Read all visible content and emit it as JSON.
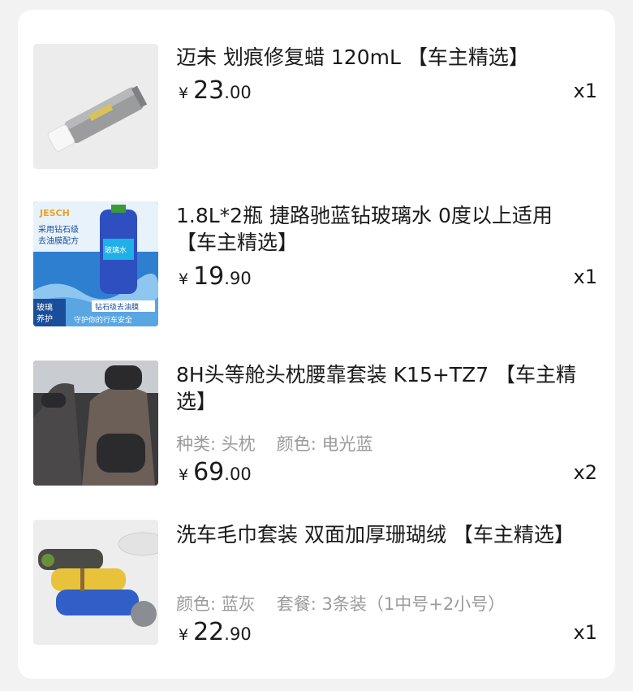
{
  "currency_symbol": "¥",
  "items": [
    {
      "title": "迈未 划痕修复蜡 120mL 【车主精选】",
      "price_int": "23",
      "price_dec": ".00",
      "qty": "x1",
      "image_icon": "scratch-repair-wax-tube-image"
    },
    {
      "title": "1.8L*2瓶 捷路驰蓝钻玻璃水 0度以上适用 【车主精选】",
      "price_int": "19",
      "price_dec": ".90",
      "qty": "x1",
      "image_icon": "windshield-washer-fluid-image",
      "image_text": {
        "brand": "JESCH",
        "line1": "采用钻石级",
        "line2": "去油膜配方",
        "tag": "玻璃水",
        "badge": "钻石级去油膜",
        "corner": "玻璃\n养护",
        "footer": "守护你的行车安全"
      }
    },
    {
      "title": "8H头等舱头枕腰靠套装 K15+TZ7 【车主精选】",
      "spec1_label": "种类:",
      "spec1_value": "头枕",
      "spec2_label": "颜色:",
      "spec2_value": "电光蓝",
      "price_int": "69",
      "price_dec": ".00",
      "qty": "x2",
      "image_icon": "headrest-lumbar-pillow-image"
    },
    {
      "title": "洗车毛巾套装 双面加厚珊瑚绒 【车主精选】",
      "spec1_label": "颜色:",
      "spec1_value": "蓝灰",
      "spec2_label": "套餐:",
      "spec2_value": "3条装（1中号+2小号）",
      "price_int": "22",
      "price_dec": ".90",
      "qty": "x1",
      "image_icon": "car-wash-towel-set-image"
    }
  ]
}
